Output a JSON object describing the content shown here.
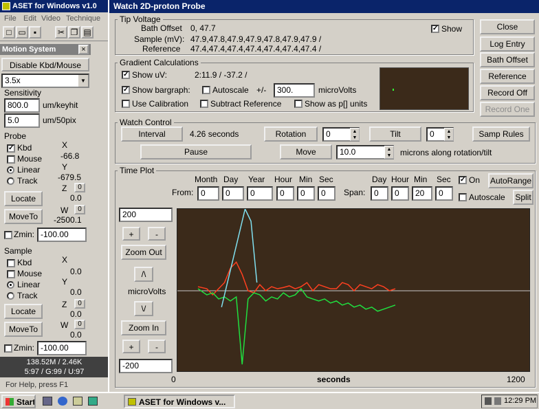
{
  "left_window": {
    "title": "ASET for Windows v1.0",
    "menu": [
      "File",
      "Edit",
      "Video",
      "Technique"
    ],
    "motion_system": {
      "title": "Motion System",
      "disable_button": "Disable Kbd/Mouse",
      "zoom_select": "3.5x",
      "sensitivity_label": "Sensitivity",
      "um_keyhit_value": "800.0",
      "um_keyhit_label": "um/keyhit",
      "um_50pix_value": "5.0",
      "um_50pix_label": "um/50pix"
    },
    "probe": {
      "label": "Probe",
      "kbd": "Kbd",
      "mouse": "Mouse",
      "linear": "Linear",
      "track": "Track",
      "x_label": "X",
      "x_value": "-66.8",
      "y_label": "Y",
      "y_value": "-679.5",
      "z_label": "Z",
      "z_value": "0.0",
      "z_small": "0",
      "w_label": "W",
      "w_value": "-2500.1",
      "w_small": "0",
      "locate": "Locate",
      "moveto": "MoveTo",
      "zmin_label": "Zmin:",
      "zmin_value": "-100.00"
    },
    "sample": {
      "label": "Sample",
      "kbd": "Kbd",
      "mouse": "Mouse",
      "linear": "Linear",
      "track": "Track",
      "x_label": "X",
      "x_value": "0.0",
      "y_label": "Y",
      "y_value": "0.0",
      "z_label": "Z",
      "z_value": "0.0",
      "z_small": "0",
      "w_label": "W",
      "w_value": "0.0",
      "w_small": "0",
      "locate": "Locate",
      "moveto": "MoveTo",
      "zmin_label": "Zmin:",
      "zmin_value": "-100.00"
    },
    "memory_line": "138.52M / 2.46K",
    "ratio_line": "5:97 / G:99 / U:97",
    "help_text": "For Help, press F1"
  },
  "probe_window": {
    "title": "Watch 2D-proton Probe",
    "tip_voltage": {
      "label": "Tip Voltage",
      "bath_offset_label": "Bath Offset",
      "bath_offset_value": "0, 47.7",
      "sample_label": "Sample (mV):",
      "sample_value": "47.9,47.8,47.9,47.9,47.8,47.9,47.9 /",
      "reference_label": "Reference",
      "reference_value": "47.4,47.4,47.4,47.4,47.4,47.4,47.4 /",
      "show_label": "Show"
    },
    "gradient": {
      "label": "Gradient Calculations",
      "show_uv_label": "Show uV:",
      "show_uv_value": "2:11.9 / -37.2 /",
      "show_bargraph_label": "Show bargraph:",
      "autoscale_label": "Autoscale",
      "plus_minus": "+/-",
      "range_value": "300.",
      "microvolts_label": "microVolts",
      "use_calibration_label": "Use Calibration",
      "subtract_reference_label": "Subtract Reference",
      "show_as_p_label": "Show as p[] units"
    },
    "side_buttons": [
      "Close",
      "Log Entry",
      "Bath Offset",
      "Reference",
      "Record Off",
      "Record One"
    ],
    "watch_control": {
      "label": "Watch Control",
      "interval_button": "Interval",
      "interval_value": "4.26 seconds",
      "rotation_button": "Rotation",
      "rotation_value": "0",
      "tilt_button": "Tilt",
      "tilt_value": "0",
      "samp_rules_button": "Samp Rules",
      "pause_button": "Pause",
      "move_button": "Move",
      "move_value": "10.0",
      "move_units": "microns along rotation/tilt"
    },
    "time_plot": {
      "label": "Time Plot",
      "headers_from": [
        "Month",
        "Day",
        "Year",
        "Hour",
        "Min",
        "Sec"
      ],
      "from_label": "From:",
      "from_values": [
        "0",
        "0",
        "0",
        "0",
        "0",
        "0"
      ],
      "headers_span": [
        "Day",
        "Hour",
        "Min",
        "Sec"
      ],
      "span_label": "Span:",
      "span_values": [
        "0",
        "0",
        "20",
        "0"
      ],
      "on_label": "On",
      "autorange_button": "AutoRange",
      "autoscale_label": "Autoscale",
      "split_button": "Split",
      "y_top_value": "200",
      "y_bottom_value": "-200",
      "plus": "+",
      "minus": "-",
      "zoom_out": "Zoom Out",
      "zoom_in": "Zoom In",
      "up_arrow": "/\\",
      "down_arrow": "\\/",
      "ylabel": "microVolts",
      "xlabel": "seconds",
      "x_min_label": "0",
      "x_max_label": "1200"
    }
  },
  "taskbar": {
    "start": "Start",
    "task": "ASET for Windows v...",
    "clock": "12:29 PM"
  },
  "chart_data": {
    "type": "line",
    "xlabel": "seconds",
    "ylabel": "microVolts",
    "xlim": [
      0,
      1200
    ],
    "ylim": [
      -200,
      200
    ],
    "series": [
      {
        "color": "#ff4020",
        "x": [
          70,
          100,
          120,
          140,
          160,
          180,
          200,
          220,
          240,
          260,
          280,
          300,
          320,
          340,
          360,
          380,
          400,
          420,
          440,
          460,
          480,
          500,
          520,
          540,
          560,
          580,
          600,
          620,
          640,
          660,
          680,
          700,
          720,
          740
        ],
        "y": [
          10,
          5,
          -10,
          5,
          20,
          55,
          70,
          40,
          0,
          -5,
          15,
          0,
          10,
          5,
          8,
          12,
          5,
          10,
          20,
          0,
          15,
          10,
          5,
          5,
          20,
          15,
          0,
          15,
          10,
          5,
          15,
          10,
          0,
          5
        ]
      },
      {
        "color": "#20e040",
        "x": [
          70,
          100,
          120,
          140,
          160,
          180,
          200,
          220,
          240,
          260,
          280,
          300,
          320,
          340,
          360,
          380,
          400,
          420,
          440,
          460,
          480,
          500,
          520,
          540,
          560,
          580,
          600,
          620,
          640,
          660,
          680,
          700,
          720,
          740
        ],
        "y": [
          5,
          -10,
          -5,
          -20,
          -15,
          -25,
          -15,
          -180,
          -20,
          -5,
          -10,
          -25,
          -15,
          -20,
          -5,
          -15,
          -10,
          5,
          -15,
          -20,
          -25,
          -20,
          -30,
          -25,
          -35,
          -30,
          -40,
          -35,
          -45,
          -40,
          -50,
          -45,
          -40,
          -35
        ]
      },
      {
        "color": "#80e0f0",
        "x": [
          150,
          170,
          190,
          210,
          230,
          250,
          270
        ],
        "y": [
          -40,
          20,
          80,
          140,
          200,
          170,
          20
        ]
      }
    ]
  }
}
